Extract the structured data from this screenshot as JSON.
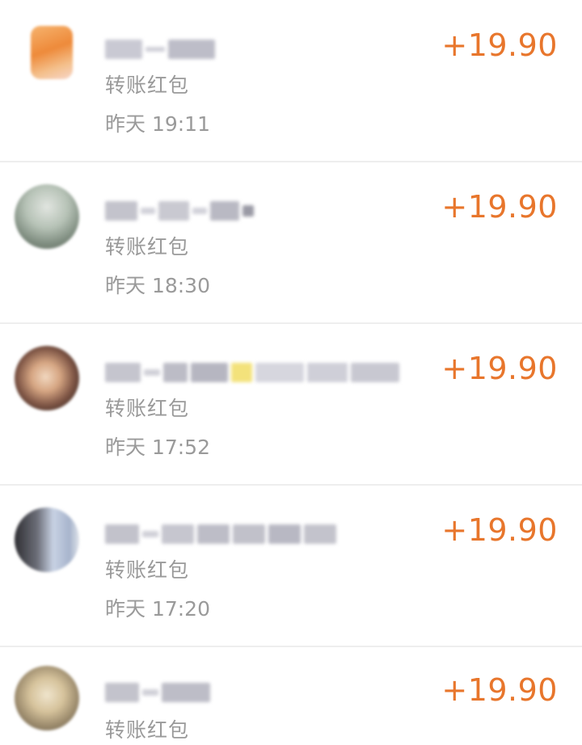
{
  "accent_color": "#e8762c",
  "secondary_text_color": "#9a9a9a",
  "transactions": [
    {
      "type_label": "转账红包",
      "time": "昨天 19:11",
      "amount": "+19.90"
    },
    {
      "type_label": "转账红包",
      "time": "昨天 18:30",
      "amount": "+19.90"
    },
    {
      "type_label": "转账红包",
      "time": "昨天 17:52",
      "amount": "+19.90"
    },
    {
      "type_label": "转账红包",
      "time": "昨天 17:20",
      "amount": "+19.90"
    },
    {
      "type_label": "转账红包",
      "time": "",
      "amount": "+19.90"
    }
  ]
}
